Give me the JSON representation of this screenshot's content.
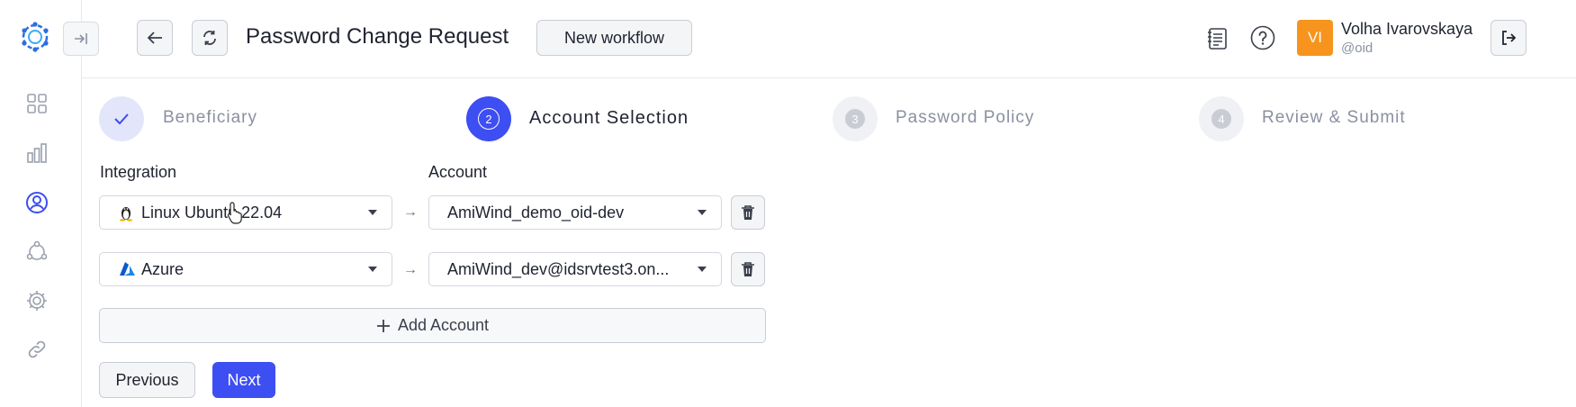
{
  "header": {
    "title": "Password Change Request",
    "new_workflow_label": "New workflow",
    "user": {
      "initials": "VI",
      "name": "Volha Ivarovskaya",
      "handle": "@oid"
    }
  },
  "stepper": {
    "steps": [
      {
        "number": "",
        "label": "Beneficiary",
        "state": "completed"
      },
      {
        "number": "2",
        "label": "Account Selection",
        "state": "active"
      },
      {
        "number": "3",
        "label": "Password Policy",
        "state": "pending"
      },
      {
        "number": "4",
        "label": "Review & Submit",
        "state": "pending"
      }
    ]
  },
  "form": {
    "integration_label": "Integration",
    "account_label": "Account",
    "rows": [
      {
        "integration": "Linux Ubuntu 22.04",
        "integration_icon": "linux-icon",
        "account": "AmiWind_demo_oid-dev"
      },
      {
        "integration": "Azure",
        "integration_icon": "azure-icon",
        "account": "AmiWind_dev@idsrvtest3.on..."
      }
    ],
    "add_account_label": "Add Account",
    "previous_label": "Previous",
    "next_label": "Next"
  },
  "colors": {
    "accent": "#3d4ef2",
    "avatar_bg": "#f7941d",
    "sidebar_active": "#3d4ef2"
  }
}
